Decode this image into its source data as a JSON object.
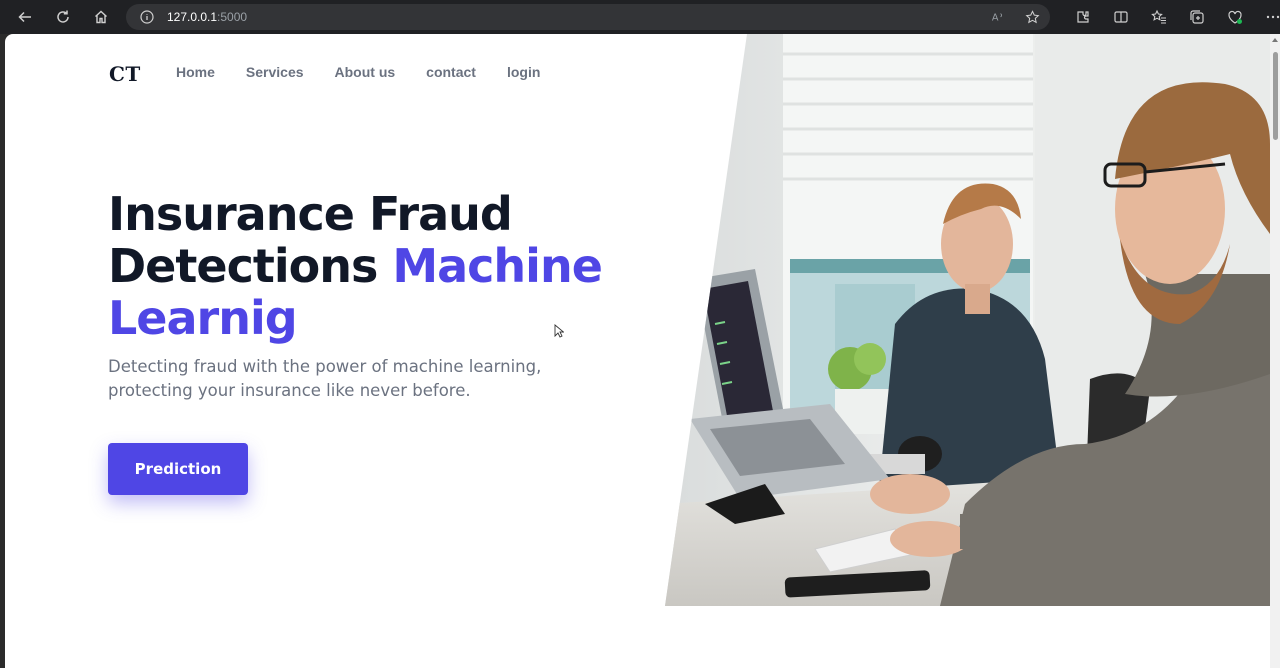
{
  "browser": {
    "url_host": "127.0.0.1",
    "url_port": ":5000"
  },
  "page": {
    "logo": "CT",
    "nav": [
      "Home",
      "Services",
      "About us",
      "contact",
      "login"
    ],
    "hero": {
      "title_line1": "Insurance Fraud",
      "title_line2": "Detections ",
      "title_accent": "Machine Learnig",
      "subtitle": "Detecting fraud with the power of machine learning, protecting your insurance like never before.",
      "cta_label": "Prediction"
    },
    "colors": {
      "accent": "#4f46e5",
      "heading": "#111827",
      "muted": "#6b7280"
    }
  }
}
